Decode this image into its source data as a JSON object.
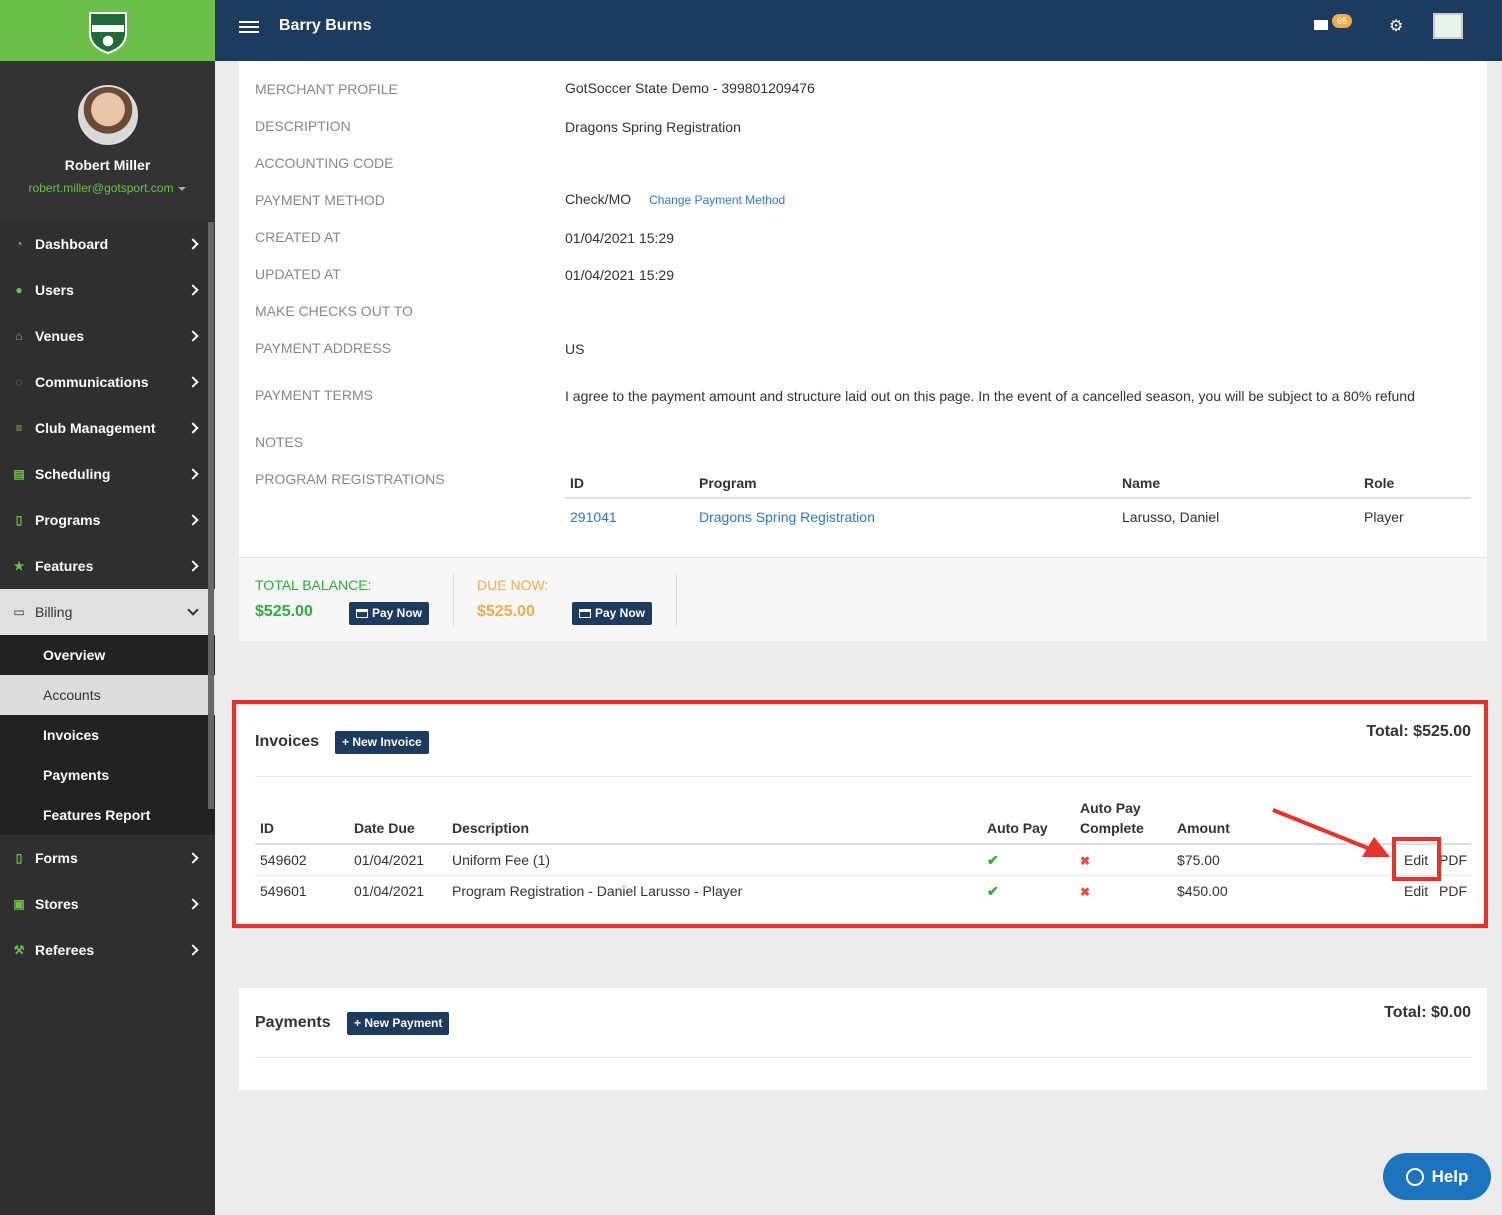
{
  "header": {
    "title": "Barry Burns",
    "mail_count": "65"
  },
  "profile": {
    "name": "Robert Miller",
    "email": "robert.miller@gotsport.com"
  },
  "nav": {
    "items": [
      {
        "label": "Dashboard",
        "icon": "dashboard-icon"
      },
      {
        "label": "Users",
        "icon": "users-icon"
      },
      {
        "label": "Venues",
        "icon": "venues-icon"
      },
      {
        "label": "Communications",
        "icon": "communications-icon"
      },
      {
        "label": "Club Management",
        "icon": "club-management-icon"
      },
      {
        "label": "Scheduling",
        "icon": "scheduling-icon"
      },
      {
        "label": "Programs",
        "icon": "programs-icon"
      },
      {
        "label": "Features",
        "icon": "star-icon"
      },
      {
        "label": "Billing",
        "icon": "billing-icon"
      }
    ],
    "billing_sub": [
      "Overview",
      "Accounts",
      "Invoices",
      "Payments",
      "Features Report"
    ],
    "after": [
      {
        "label": "Forms",
        "icon": "forms-icon"
      },
      {
        "label": "Stores",
        "icon": "stores-icon"
      },
      {
        "label": "Referees",
        "icon": "referees-icon"
      }
    ]
  },
  "details": {
    "merchant_profile_label": "MERCHANT PROFILE",
    "merchant_profile": "GotSoccer State Demo - 399801209476",
    "description_label": "DESCRIPTION",
    "description": "Dragons Spring Registration",
    "accounting_code_label": "ACCOUNTING CODE",
    "payment_method_label": "PAYMENT METHOD",
    "payment_method": "Check/MO",
    "change_payment_method": "Change Payment Method",
    "created_at_label": "CREATED AT",
    "created_at": "01/04/2021 15:29",
    "updated_at_label": "UPDATED AT",
    "updated_at": "01/04/2021 15:29",
    "make_checks_label": "MAKE CHECKS OUT TO",
    "payment_address_label": "PAYMENT ADDRESS",
    "payment_address": "US",
    "payment_terms_label": "PAYMENT TERMS",
    "payment_terms": "I agree to the payment amount and structure laid out on this page. In the event of a cancelled season, you will be subject to a 80% refund",
    "notes_label": "NOTES",
    "program_registrations_label": "PROGRAM REGISTRATIONS"
  },
  "registrations": {
    "headers": [
      "ID",
      "Program",
      "Name",
      "Role"
    ],
    "rows": [
      {
        "id": "291041",
        "program": "Dragons Spring Registration",
        "name": "Larusso, Daniel",
        "role": "Player"
      }
    ]
  },
  "balance": {
    "total_label": "TOTAL BALANCE:",
    "total_amount": "$525.00",
    "due_label": "DUE NOW:",
    "due_amount": "$525.00",
    "pay_now": "Pay Now"
  },
  "invoices": {
    "title": "Invoices",
    "new_button": "+ New Invoice",
    "total": "Total: $525.00",
    "headers": {
      "id": "ID",
      "date_due": "Date Due",
      "description": "Description",
      "auto_pay": "Auto Pay",
      "auto_pay_complete_1": "Auto Pay",
      "auto_pay_complete_2": "Complete",
      "amount": "Amount"
    },
    "rows": [
      {
        "id": "549602",
        "date_due": "01/04/2021",
        "description": "Uniform Fee (1)",
        "auto_pay": "✔",
        "complete": "✖",
        "amount": "$75.00",
        "edit": "Edit",
        "pdf": "PDF"
      },
      {
        "id": "549601",
        "date_due": "01/04/2021",
        "description": "Program Registration - Daniel Larusso - Player",
        "auto_pay": "✔",
        "complete": "✖",
        "amount": "$450.00",
        "edit": "Edit",
        "pdf": "PDF"
      }
    ]
  },
  "payments": {
    "title": "Payments",
    "new_button": "+ New Payment",
    "total": "Total: $0.00"
  },
  "help": {
    "label": "Help"
  },
  "colors": {
    "header": "#1c3b5e",
    "green": "#6cc04a",
    "balance_green": "#2eae3d",
    "due_orange": "#f0ad4e",
    "link": "#2d7bc4",
    "annotation_red": "#e8312b"
  }
}
